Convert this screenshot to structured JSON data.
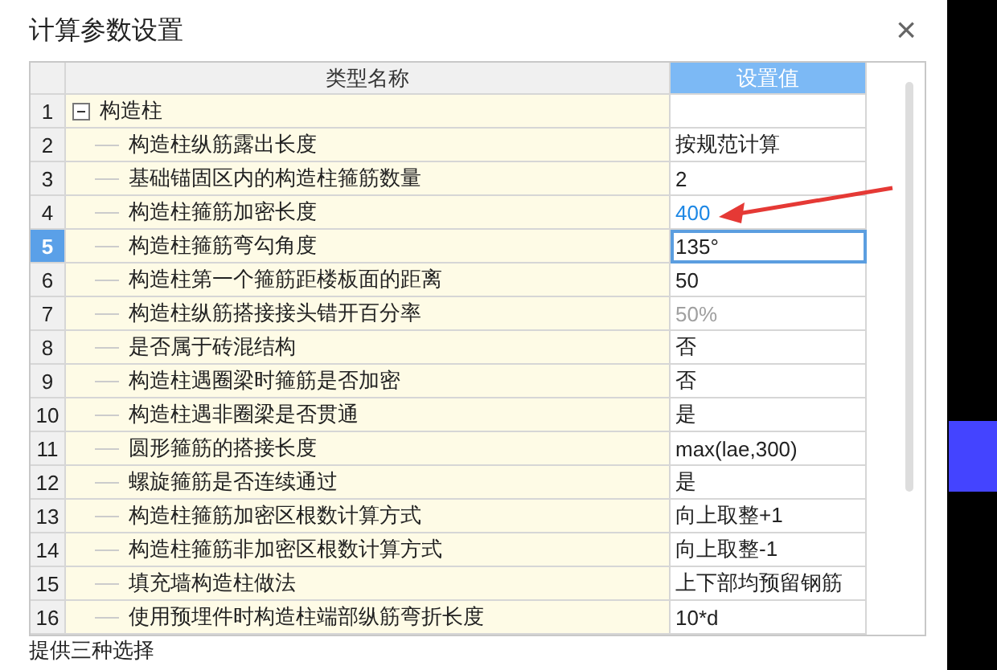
{
  "window": {
    "title": "计算参数设置",
    "close": "×"
  },
  "table": {
    "columns": [
      "类型名称",
      "设置值"
    ],
    "rows": [
      {
        "number": "1",
        "name": "构造柱",
        "value": "",
        "expanded": true,
        "selected": false,
        "children": [
          {
            "number": "2",
            "name": "构造柱纵筋露出长度",
            "value": "按规范计算",
            "selected": false,
            "modified": false,
            "disabled": false
          },
          {
            "number": "3",
            "name": "基础锚固区内的构造柱箍筋数量",
            "value": "2",
            "selected": false,
            "modified": false,
            "disabled": false
          },
          {
            "number": "4",
            "name": "构造柱箍筋加密长度",
            "value": "400",
            "selected": false,
            "modified": true,
            "disabled": false
          },
          {
            "number": "5",
            "name": "构造柱箍筋弯勾角度",
            "value": "135°",
            "selected": true,
            "modified": false,
            "disabled": false
          },
          {
            "number": "6",
            "name": "构造柱第一个箍筋距楼板面的距离",
            "value": "50",
            "selected": false,
            "modified": false,
            "disabled": false
          },
          {
            "number": "7",
            "name": "构造柱纵筋搭接接头错开百分率",
            "value": "50%",
            "selected": false,
            "modified": false,
            "disabled": true
          },
          {
            "number": "8",
            "name": "是否属于砖混结构",
            "value": "否",
            "selected": false,
            "modified": false,
            "disabled": false
          },
          {
            "number": "9",
            "name": "构造柱遇圈梁时箍筋是否加密",
            "value": "否",
            "selected": false,
            "modified": false,
            "disabled": false
          },
          {
            "number": "10",
            "name": "构造柱遇非圈梁是否贯通",
            "value": "是",
            "selected": false,
            "modified": false,
            "disabled": false
          },
          {
            "number": "11",
            "name": "圆形箍筋的搭接长度",
            "value": "max(lae,300)",
            "selected": false,
            "modified": false,
            "disabled": false
          },
          {
            "number": "12",
            "name": "螺旋箍筋是否连续通过",
            "value": "是",
            "selected": false,
            "modified": false,
            "disabled": false
          },
          {
            "number": "13",
            "name": "构造柱箍筋加密区根数计算方式",
            "value": "向上取整+1",
            "selected": false,
            "modified": false,
            "disabled": false
          },
          {
            "number": "14",
            "name": "构造柱箍筋非加密区根数计算方式",
            "value": "向上取整-1",
            "selected": false,
            "modified": false,
            "disabled": false
          },
          {
            "number": "15",
            "name": "填充墙构造柱做法",
            "value": "上下部均预留钢筋",
            "selected": false,
            "modified": false,
            "disabled": false
          },
          {
            "number": "16",
            "name": "使用预埋件时构造柱端部纵筋弯折长度",
            "value": "10*d",
            "selected": false,
            "modified": false,
            "disabled": false
          }
        ]
      }
    ]
  },
  "description": "提供三种选择"
}
